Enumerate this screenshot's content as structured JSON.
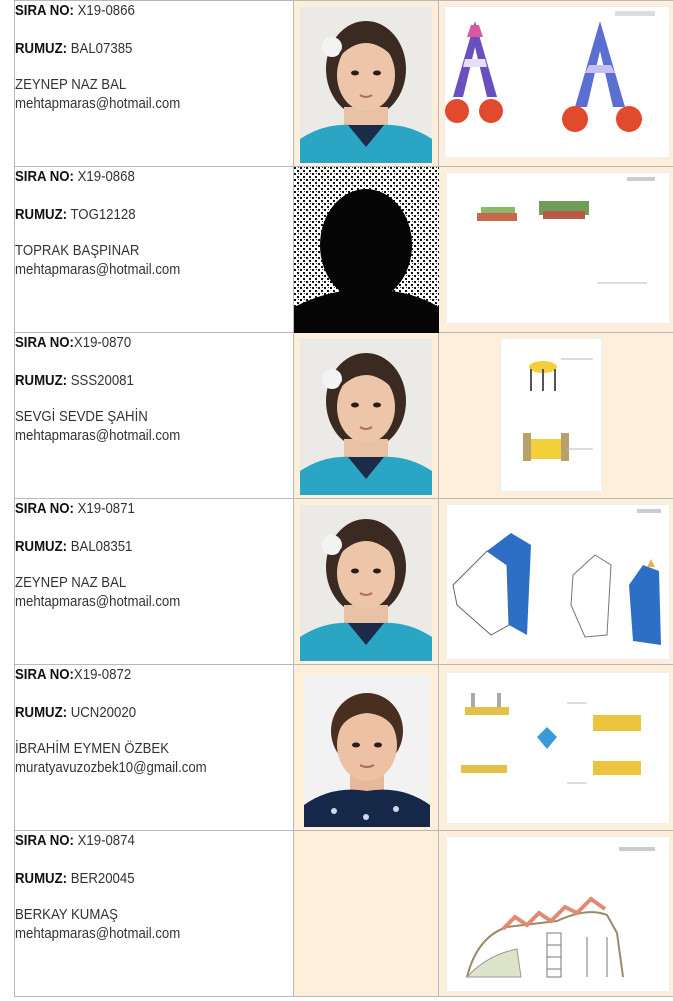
{
  "labels": {
    "sira_no": "SIRA NO:",
    "rumuz": "RUMUZ:"
  },
  "entries": [
    {
      "sira_no": " X19-0866",
      "rumuz": " BAL07385",
      "name": "ZEYNEP NAZ BAL",
      "email": "mehtapmaras@hotmail.com"
    },
    {
      "sira_no": " X19-0868",
      "rumuz": " TOG12128",
      "name": "TOPRAK BAŞPINAR",
      "email": "mehtapmaras@hotmail.com"
    },
    {
      "sira_no": "X19-0870",
      "rumuz": " SSS20081",
      "name": "SEVGİ SEVDE ŞAHİN",
      "email": "mehtapmaras@hotmail.com"
    },
    {
      "sira_no": " X19-0871",
      "rumuz": " BAL08351",
      "name": "ZEYNEP NAZ BAL",
      "email": "mehtapmaras@hotmail.com"
    },
    {
      "sira_no": "X19-0872",
      "rumuz": " UCN20020",
      "name": "İBRAHİM EYMEN ÖZBEK",
      "email": "muratyavuzozbek10@gmail.com"
    },
    {
      "sira_no": " X19-0874",
      "rumuz": " BER20045",
      "name": "BERKAY KUMAŞ",
      "email": "mehtapmaras@hotmail.com"
    }
  ],
  "colors": {
    "cell_background": "#fdefd9",
    "border": "#b9b9b9",
    "uniform": "#2aa6c4",
    "hair": "#3b2a22"
  },
  "icons": {
    "photo": "student-photo-icon",
    "drawing": "design-drawing-icon"
  }
}
